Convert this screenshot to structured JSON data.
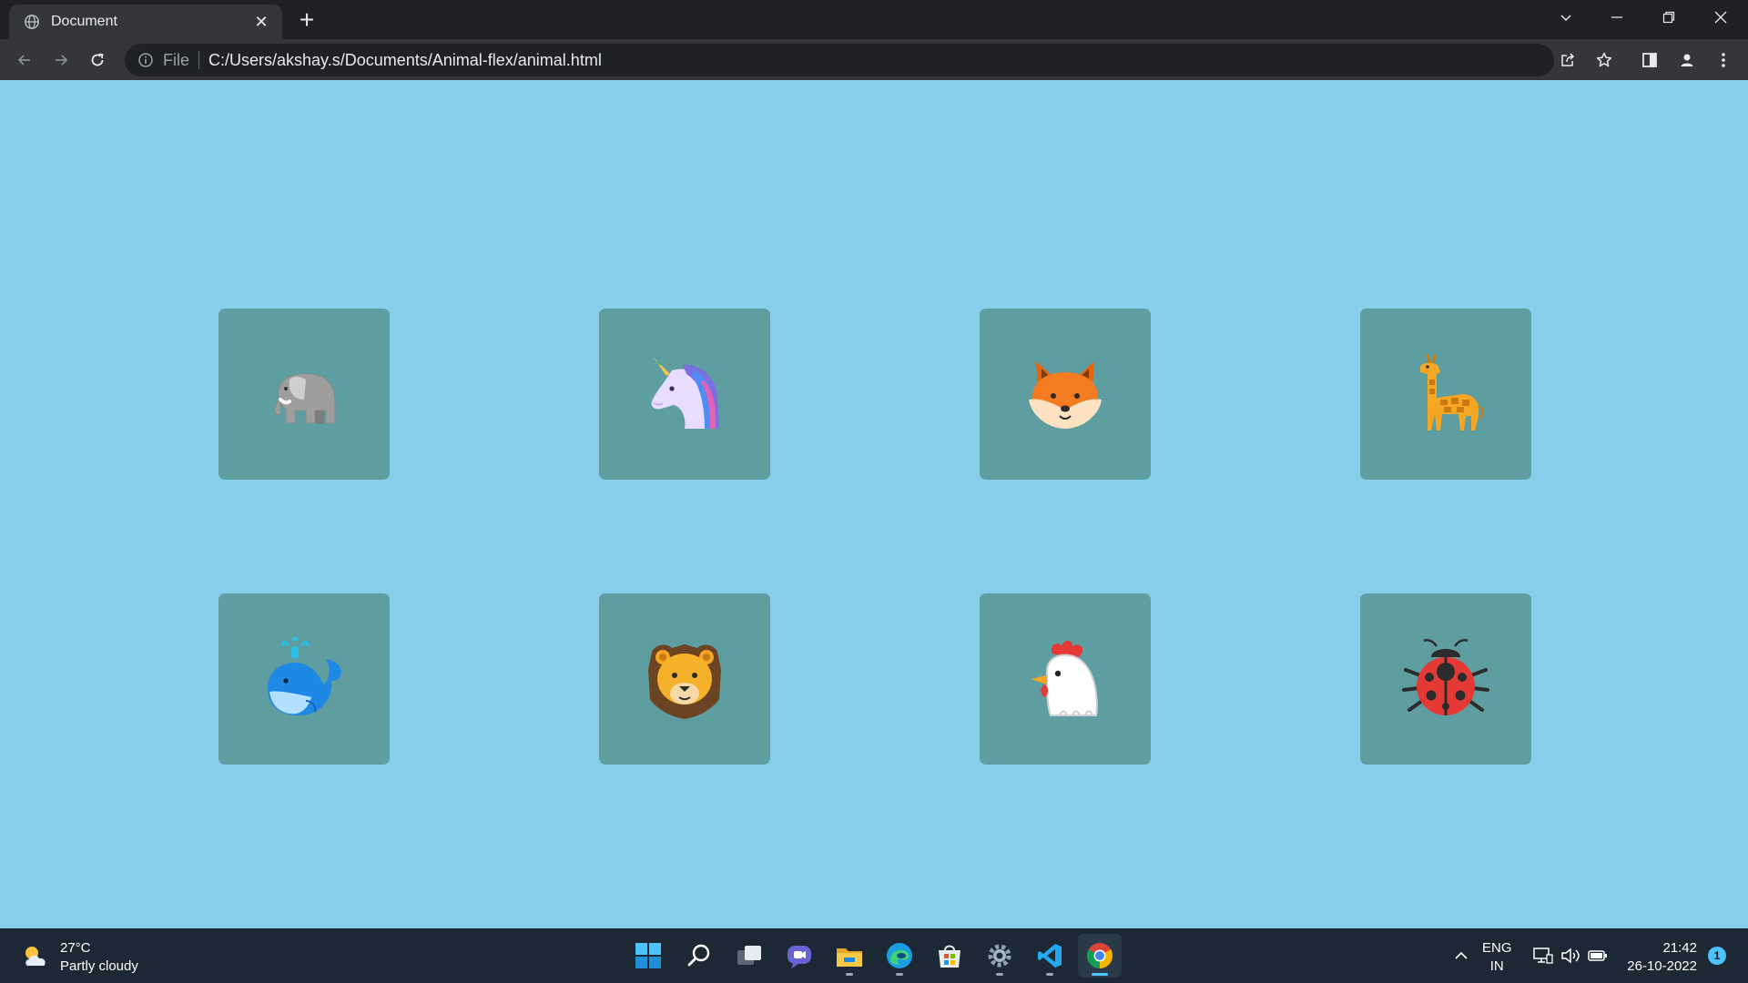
{
  "browser": {
    "tab": {
      "title": "Document",
      "favicon": "globe-icon"
    },
    "address": {
      "scheme_label": "File",
      "url": "C:/Users/akshay.s/Documents/Animal-flex/animal.html"
    }
  },
  "page": {
    "background": "#87CEEB",
    "card_color": "#5F9EA0",
    "cards": [
      {
        "name": "elephant",
        "icon": "elephant-icon"
      },
      {
        "name": "unicorn",
        "icon": "unicorn-icon"
      },
      {
        "name": "fox",
        "icon": "fox-icon"
      },
      {
        "name": "giraffe",
        "icon": "giraffe-icon"
      },
      {
        "name": "whale",
        "icon": "whale-icon"
      },
      {
        "name": "lion",
        "icon": "lion-icon"
      },
      {
        "name": "rooster",
        "icon": "rooster-icon"
      },
      {
        "name": "ladybug",
        "icon": "ladybug-icon"
      }
    ]
  },
  "taskbar": {
    "weather": {
      "temp": "27°C",
      "condition": "Partly cloudy"
    },
    "apps": [
      "start",
      "search",
      "task-view",
      "chat",
      "file-explorer",
      "edge",
      "store",
      "settings",
      "vscode",
      "chrome"
    ],
    "language": {
      "line1": "ENG",
      "line2": "IN"
    },
    "clock": {
      "time": "21:42",
      "date": "26-10-2022"
    },
    "notification_count": "1"
  }
}
